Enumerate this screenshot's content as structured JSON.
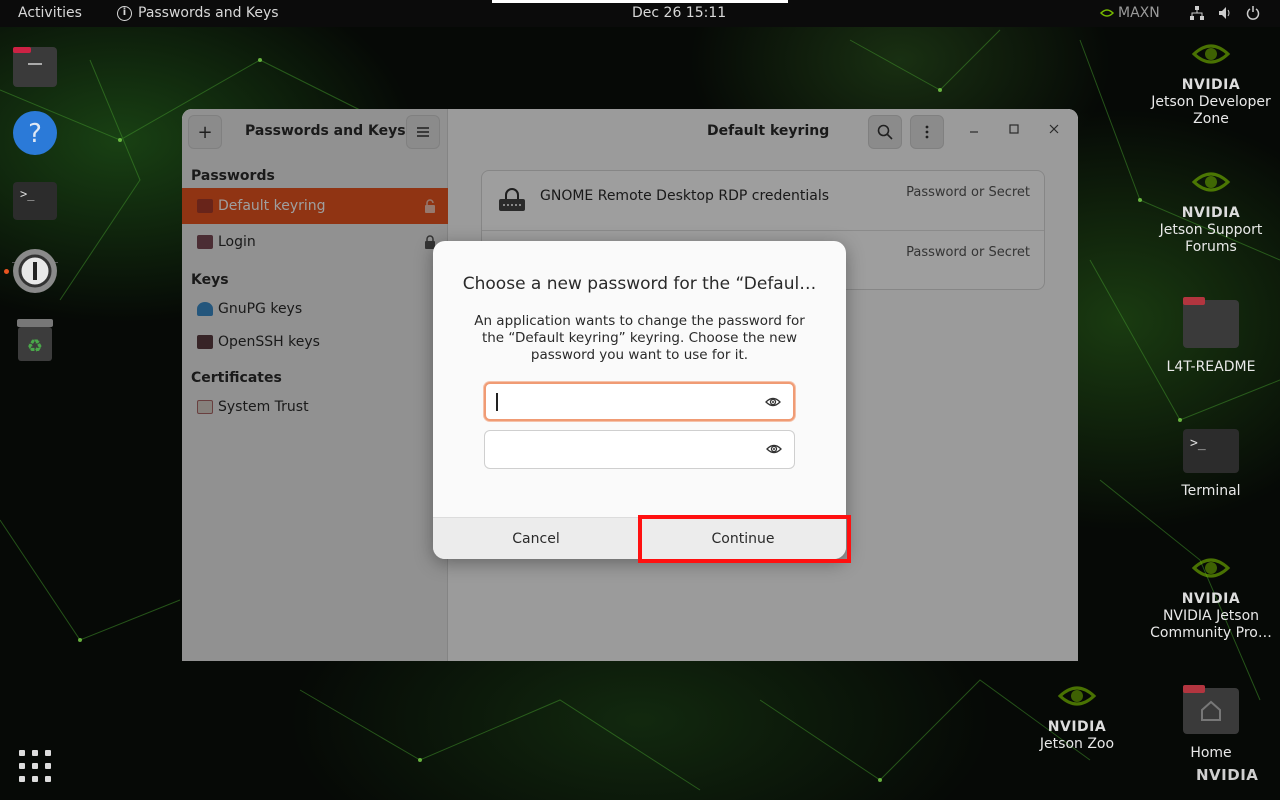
{
  "topbar": {
    "activities": "Activities",
    "app_name": "Passwords and Keys",
    "clock": "Dec 26  15:11",
    "power_mode": "MAXN"
  },
  "dock": {
    "items": [
      "files-icon",
      "help-icon",
      "terminal-icon",
      "1password-icon",
      "trash-icon",
      "app-grid-icon"
    ]
  },
  "desktop": {
    "icons": [
      {
        "label": "Jetson Developer Zone",
        "brand": "NVIDIA"
      },
      {
        "label": "Jetson Support Forums",
        "brand": "NVIDIA"
      },
      {
        "label": "L4T-README"
      },
      {
        "label": "Terminal"
      },
      {
        "label": "NVIDIA Jetson Community Pro…",
        "brand": "NVIDIA"
      },
      {
        "label": "Jetson Zoo",
        "brand": "NVIDIA"
      },
      {
        "label": "Home"
      }
    ],
    "nvidia_wordmark": "NVIDIA"
  },
  "window": {
    "sidebar_title": "Passwords and Keys",
    "content_title": "Default keyring",
    "sections": {
      "passwords": "Passwords",
      "keys": "Keys",
      "certificates": "Certificates"
    },
    "items": {
      "default_keyring": "Default keyring",
      "login": "Login",
      "gnupg": "GnuPG keys",
      "openssh": "OpenSSH keys",
      "system_trust": "System Trust"
    },
    "rows": [
      {
        "name": "GNOME Remote Desktop RDP credentials",
        "type": "Password or Secret"
      },
      {
        "name": "",
        "type": "Password or Secret"
      }
    ]
  },
  "dialog": {
    "title": "Choose a new password for the “Defaul…",
    "body": "An application wants to change the password for the “Default keyring” keyring. Choose the new password you want to use for it.",
    "password_value": "",
    "confirm_value": "",
    "cancel": "Cancel",
    "continue": "Continue"
  },
  "colors": {
    "accent": "#e95420",
    "highlight": "#ff1010",
    "nvidia_green": "#76b900"
  }
}
